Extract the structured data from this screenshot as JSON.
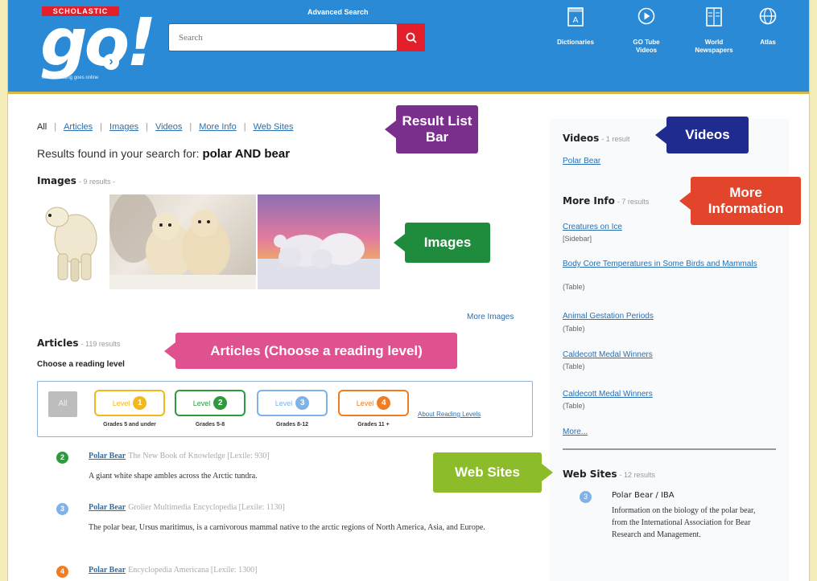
{
  "header": {
    "logo_badge": "SCHOLASTIC",
    "logo_text": "go!",
    "logo_tagline": "understanding goes online",
    "advanced_search": "Advanced Search",
    "search_placeholder": "Search",
    "nav": [
      {
        "label": "Dictionaries",
        "icon": "dictionary-icon"
      },
      {
        "label": "GO Tube\nVideos",
        "icon": "play-icon"
      },
      {
        "label": "World\nNewspapers",
        "icon": "newspaper-icon"
      },
      {
        "label": "Atlas",
        "icon": "globe-icon"
      }
    ]
  },
  "result_bar": {
    "all": "All",
    "links": [
      "Articles",
      "Images",
      "Videos",
      "More Info",
      "Web Sites"
    ]
  },
  "results_found": {
    "prefix": "Results found in your search for:",
    "query": "polar AND bear"
  },
  "images": {
    "title": "Images",
    "count": "- 9 results -",
    "more": "More Images"
  },
  "articles": {
    "title": "Articles",
    "count": "- 119 results",
    "reading_label": "Choose a reading level",
    "all_button": "All",
    "levels": [
      {
        "label": "Level",
        "num": "1",
        "grades": "Grades 5 and under",
        "color": "#f2b81c"
      },
      {
        "label": "Level",
        "num": "2",
        "grades": "Grades 5-8",
        "color": "#2e9a3e"
      },
      {
        "label": "Level",
        "num": "3",
        "grades": "Grades 8-12",
        "color": "#7fb2e6"
      },
      {
        "label": "Level",
        "num": "4",
        "grades": "Grades 11 +",
        "color": "#ee7d24"
      }
    ],
    "about_levels": "About Reading Levels",
    "items": [
      {
        "num": "2",
        "color": "#2e9a3e",
        "title": "Polar Bear",
        "source": "The New Book of Knowledge [Lexile: 930]",
        "desc": "A giant white shape ambles across the Arctic tundra."
      },
      {
        "num": "3",
        "color": "#7fb2e6",
        "title": "Polar Bear",
        "source": "Grolier Multimedia Encyclopedia [Lexile: 1130]",
        "desc": "The polar bear, Ursus maritimus, is a carnivorous mammal native to the arctic regions of North America, Asia, and Europe."
      },
      {
        "num": "4",
        "color": "#ee7d24",
        "title": "Polar Bear",
        "source": "Encyclopedia Americana [Lexile: 1300]",
        "desc": ""
      }
    ]
  },
  "right": {
    "videos": {
      "title": "Videos",
      "count": "- 1 result",
      "items": [
        "Polar Bear"
      ]
    },
    "more_info": {
      "title": "More Info",
      "count": "- 7 results",
      "items": [
        {
          "title": "Creatures on Ice",
          "type": "[Sidebar]"
        },
        {
          "title": "Body Core Temperatures in Some Birds and Mammals",
          "type": "(Table)"
        },
        {
          "title": "Animal Gestation Periods",
          "type": "(Table)"
        },
        {
          "title": "Caldecott Medal Winners",
          "type": "(Table)"
        },
        {
          "title": "Caldecott Medal Winners",
          "type": "(Table)"
        }
      ],
      "more": "More..."
    },
    "web_sites": {
      "title": "Web Sites",
      "count": "- 12 results",
      "num": "3",
      "item_title": "Polar Bear / IBA",
      "item_desc": "Information on the biology of the polar bear, from the International Association for Bear Research and Management."
    }
  },
  "callouts": {
    "result_list_bar": "Result List Bar",
    "videos": "Videos",
    "more_information": "More Information",
    "images": "Images",
    "articles": "Articles (Choose a reading level)",
    "web_sites": "Web Sites"
  },
  "colors": {
    "header_blue": "#2b8ad6",
    "search_red": "#e41f2c",
    "callout_purple": "#7b2f8c",
    "callout_navy": "#1f2b8f",
    "callout_red": "#e3452c",
    "callout_green": "#1f8b3d",
    "callout_pink": "#e0528f",
    "callout_lime": "#8cbc2a"
  }
}
